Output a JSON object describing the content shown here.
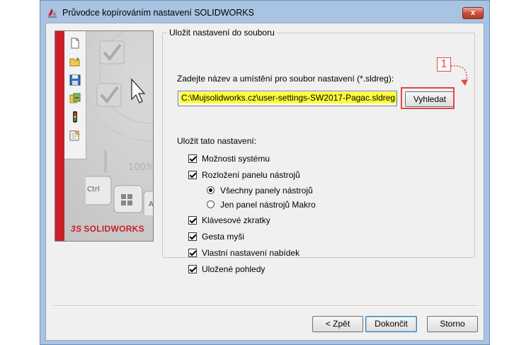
{
  "window": {
    "title": "Průvodce kopírováním nastavení SOLIDWORKS",
    "app_icon": "solidworks-app-icon",
    "close_glyph": "x"
  },
  "banner": {
    "logo_text": "SOLIDWORKS",
    "logo_prefix": "3S",
    "tool_icons": [
      "new-document-icon",
      "open-folder-icon",
      "save-icon",
      "copy-settings-icon",
      "traffic-light-icon",
      "properties-icon"
    ],
    "accent_color": "#c8202a"
  },
  "group": {
    "title": "Uložit nastavení do souboru",
    "prompt": "Zadejte název a umístění pro soubor nastavení (*.sldreg):",
    "path_value": "C:\\Mujsolidworks.cz\\user-settings-SW2017-Pagac.sldreg",
    "browse_label": "Vyhledat",
    "callout_number": "1",
    "save_label": "Uložit tato nastavení:",
    "options": [
      {
        "label": "Možnosti systému",
        "checked": true
      },
      {
        "label": "Rozložení panelu nástrojů",
        "checked": true
      },
      {
        "label": "Klávesové zkratky",
        "checked": true
      },
      {
        "label": "Gesta myši",
        "checked": true
      },
      {
        "label": "Vlastní nastavení nabídek",
        "checked": true
      },
      {
        "label": "Uložené pohledy",
        "checked": true
      }
    ],
    "toolbar_radios": [
      {
        "label": "Všechny panely nástrojů",
        "selected": true
      },
      {
        "label": "Jen panel nástrojů Makro",
        "selected": false
      }
    ]
  },
  "footer": {
    "back_label": "< Zpět",
    "finish_label": "Dokončit",
    "cancel_label": "Storno"
  }
}
